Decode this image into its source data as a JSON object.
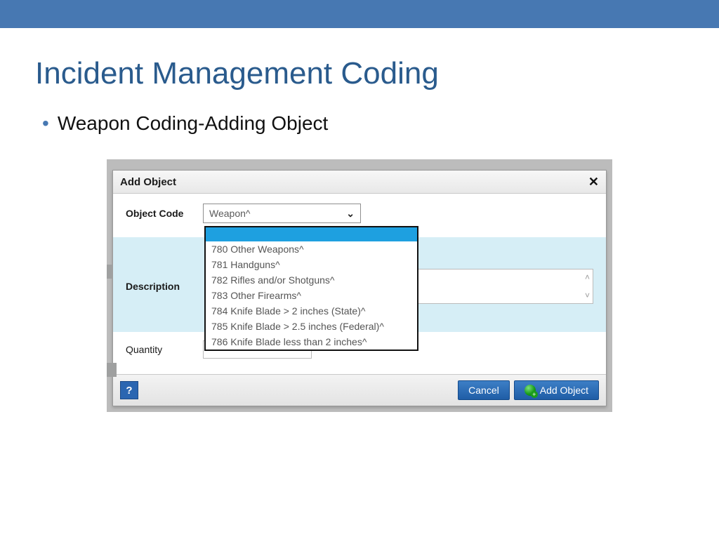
{
  "slide": {
    "title": "Incident Management Coding",
    "bullet": "Weapon Coding-Adding Object"
  },
  "dialog": {
    "title": "Add Object",
    "close_glyph": "✕",
    "object_code": {
      "label": "Object Code",
      "selected": "Weapon^",
      "options": [
        "",
        "780 Other Weapons^",
        "781 Handguns^",
        "782 Rifles and/or Shotguns^",
        "783 Other Firearms^",
        "784 Knife Blade > 2 inches (State)^",
        "785 Knife Blade > 2.5 inches (Federal)^",
        "786 Knife Blade less than 2 inches^"
      ]
    },
    "description": {
      "label": "Description",
      "value": ""
    },
    "quantity": {
      "label": "Quantity",
      "value": ""
    },
    "footer": {
      "help_glyph": "?",
      "cancel": "Cancel",
      "add": "Add Object"
    }
  }
}
